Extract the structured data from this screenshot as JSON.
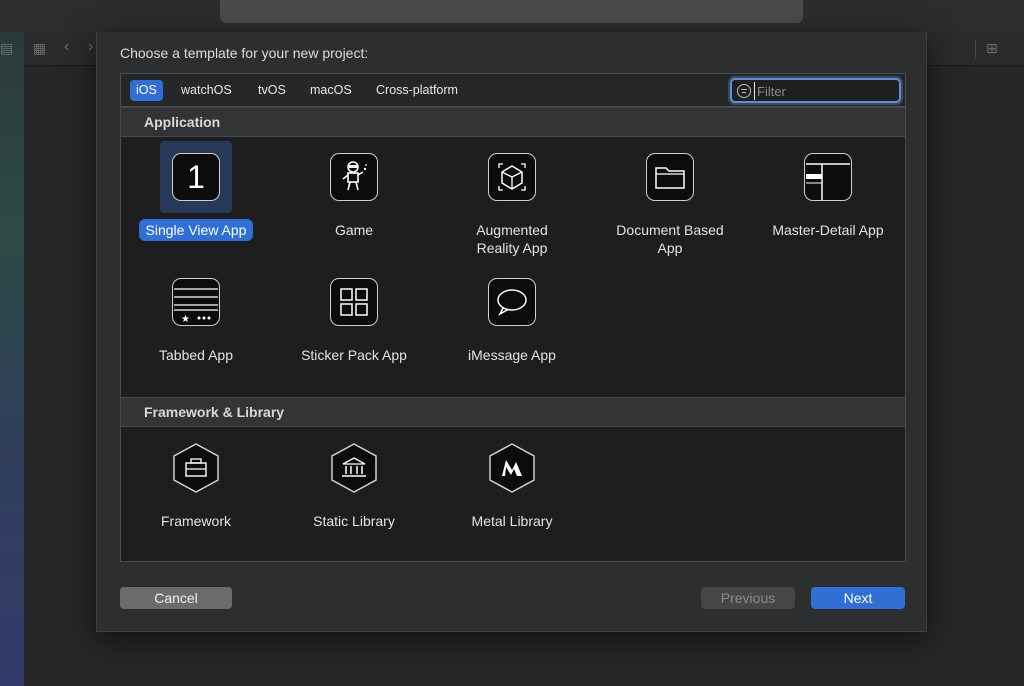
{
  "dialog": {
    "title": "Choose a template for your new project:"
  },
  "platform_tabs": [
    {
      "label": "iOS",
      "selected": true
    },
    {
      "label": "watchOS",
      "selected": false
    },
    {
      "label": "tvOS",
      "selected": false
    },
    {
      "label": "macOS",
      "selected": false
    },
    {
      "label": "Cross-platform",
      "selected": false
    }
  ],
  "filter": {
    "placeholder": "Filter",
    "value": ""
  },
  "sections": [
    {
      "header": "Application",
      "templates": [
        {
          "label": "Single View App",
          "icon": "single-view-app-icon",
          "selected": true
        },
        {
          "label": "Game",
          "icon": "game-icon",
          "selected": false
        },
        {
          "label": "Augmented Reality App",
          "icon": "augmented-reality-icon",
          "selected": false
        },
        {
          "label": "Document Based App",
          "icon": "document-based-icon",
          "selected": false
        },
        {
          "label": "Master-Detail App",
          "icon": "master-detail-icon",
          "selected": false
        },
        {
          "label": "Tabbed App",
          "icon": "tabbed-app-icon",
          "selected": false
        },
        {
          "label": "Sticker Pack App",
          "icon": "sticker-pack-icon",
          "selected": false
        },
        {
          "label": "iMessage App",
          "icon": "imessage-icon",
          "selected": false
        }
      ]
    },
    {
      "header": "Framework & Library",
      "templates": [
        {
          "label": "Framework",
          "icon": "framework-icon",
          "selected": false
        },
        {
          "label": "Static Library",
          "icon": "static-library-icon",
          "selected": false
        },
        {
          "label": "Metal Library",
          "icon": "metal-library-icon",
          "selected": false
        }
      ]
    }
  ],
  "single_view_glyph": "1",
  "buttons": {
    "cancel": "Cancel",
    "previous": "Previous",
    "next": "Next"
  },
  "colors": {
    "accent": "#2f6fd6",
    "selection_bg": "#263958",
    "panel_bg": "#1e1e1f"
  }
}
